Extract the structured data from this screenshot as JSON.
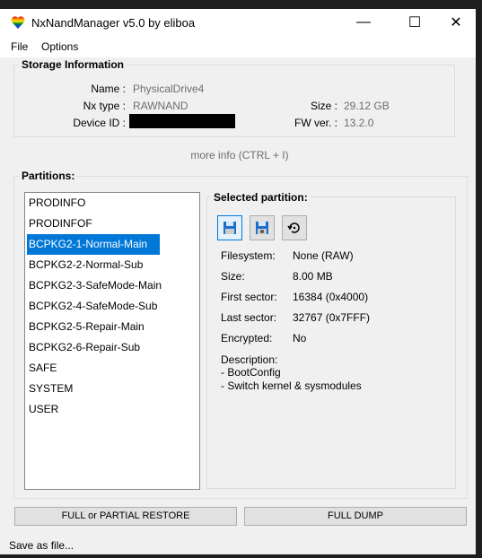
{
  "window": {
    "title": "NxNandManager v5.0 by eliboa",
    "minimize": "—",
    "maximize": "☐",
    "close": "✕"
  },
  "menu": [
    "File",
    "Options"
  ],
  "storage": {
    "title": "Storage Information",
    "name_label": "Name :",
    "name_value": "PhysicalDrive4",
    "type_label": "Nx type :",
    "type_value": "RAWNAND",
    "device_label": "Device ID :",
    "size_label": "Size :",
    "size_value": "29.12 GB",
    "fw_label": "FW ver. :",
    "fw_value": "13.2.0",
    "more_info": "more info (CTRL + I)"
  },
  "partitions": {
    "title": "Partitions:",
    "items": [
      "PRODINFO",
      "PRODINFOF",
      "BCPKG2-1-Normal-Main",
      "BCPKG2-2-Normal-Sub",
      "BCPKG2-3-SafeMode-Main",
      "BCPKG2-4-SafeMode-Sub",
      "BCPKG2-5-Repair-Main",
      "BCPKG2-6-Repair-Sub",
      "SAFE",
      "SYSTEM",
      "USER"
    ],
    "selected": "BCPKG2-1-Normal-Main"
  },
  "selected_partition": {
    "title": "Selected partition:",
    "fields": [
      {
        "label": "Filesystem:",
        "value": "None (RAW)"
      },
      {
        "label": "Size:",
        "value": "8.00 MB"
      },
      {
        "label": "First sector:",
        "value": "16384 (0x4000)"
      },
      {
        "label": "Last sector:",
        "value": "32767 (0x7FFF)"
      },
      {
        "label": "Encrypted:",
        "value": "No"
      }
    ],
    "description_label": "Description:",
    "description_lines": [
      "- BootConfig",
      "- Switch kernel & sysmodules"
    ]
  },
  "buttons": {
    "restore": "FULL or PARTIAL RESTORE",
    "dump": "FULL DUMP"
  },
  "status": "Save as file...",
  "colors": {
    "accent": "#0078d7",
    "background": "#f0f0f0"
  }
}
